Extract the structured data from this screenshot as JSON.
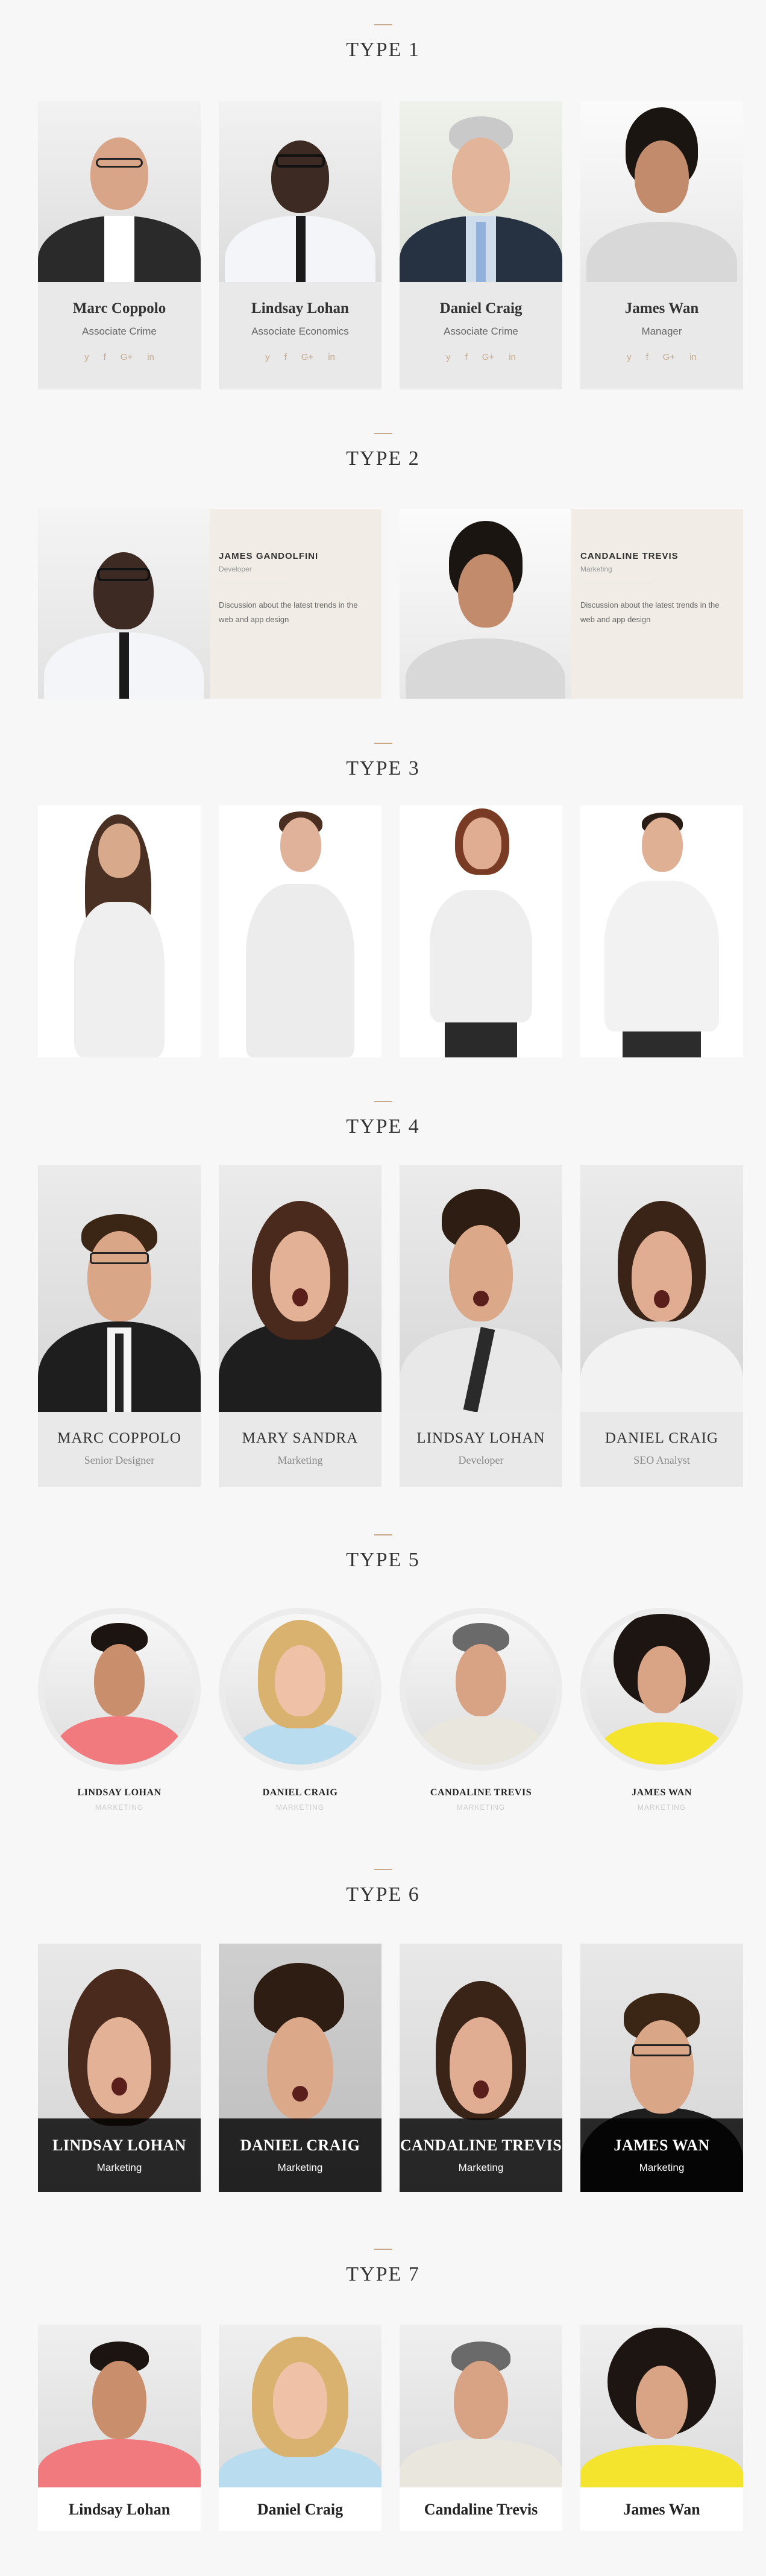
{
  "colors": {
    "accent": "#c9a98a",
    "background": "#f7f7f7",
    "overlay": "#000000"
  },
  "type1": {
    "title": "TYPE 1",
    "members": [
      {
        "name": "Marc Coppolo",
        "role": "Associate Crime"
      },
      {
        "name": "Lindsay Lohan",
        "role": "Associate Economics"
      },
      {
        "name": "Daniel Craig",
        "role": "Associate Crime"
      },
      {
        "name": "James Wan",
        "role": "Manager"
      }
    ],
    "social": [
      "twitter-icon",
      "facebook-icon",
      "google-plus-icon",
      "linkedin-icon"
    ],
    "social_glyphs": [
      "y",
      "f",
      "G+",
      "in"
    ]
  },
  "type2": {
    "title": "TYPE 2",
    "members": [
      {
        "name": "JAMES GANDOLFINI",
        "role": "Developer",
        "desc": "Discussion about the latest trends in the web and app design"
      },
      {
        "name": "CANDALINE TREVIS",
        "role": "Marketing",
        "desc": "Discussion about the latest trends in the web and app design"
      }
    ]
  },
  "type3": {
    "title": "TYPE 3"
  },
  "type4": {
    "title": "TYPE 4",
    "members": [
      {
        "name": "MARC COPPOLO",
        "role": "Senior Designer"
      },
      {
        "name": "MARY SANDRA",
        "role": "Marketing"
      },
      {
        "name": "LINDSAY LOHAN",
        "role": "Developer"
      },
      {
        "name": "DANIEL CRAIG",
        "role": "SEO Analyst"
      }
    ]
  },
  "type5": {
    "title": "TYPE 5",
    "members": [
      {
        "name": "LINDSAY LOHAN",
        "role": "MARKETING"
      },
      {
        "name": "DANIEL CRAIG",
        "role": "MARKETING"
      },
      {
        "name": "CANDALINE TREVIS",
        "role": "MARKETING"
      },
      {
        "name": "JAMES WAN",
        "role": "MARKETING"
      }
    ]
  },
  "type6": {
    "title": "TYPE 6",
    "members": [
      {
        "name": "LINDSAY LOHAN",
        "role": "Marketing"
      },
      {
        "name": "DANIEL CRAIG",
        "role": "Marketing"
      },
      {
        "name": "CANDALINE TREVIS",
        "role": "Marketing"
      },
      {
        "name": "JAMES WAN",
        "role": "Marketing"
      }
    ]
  },
  "type7": {
    "title": "TYPE 7",
    "members": [
      {
        "name": "Lindsay Lohan"
      },
      {
        "name": "Daniel Craig"
      },
      {
        "name": "Candaline Trevis"
      },
      {
        "name": "James Wan"
      }
    ]
  }
}
